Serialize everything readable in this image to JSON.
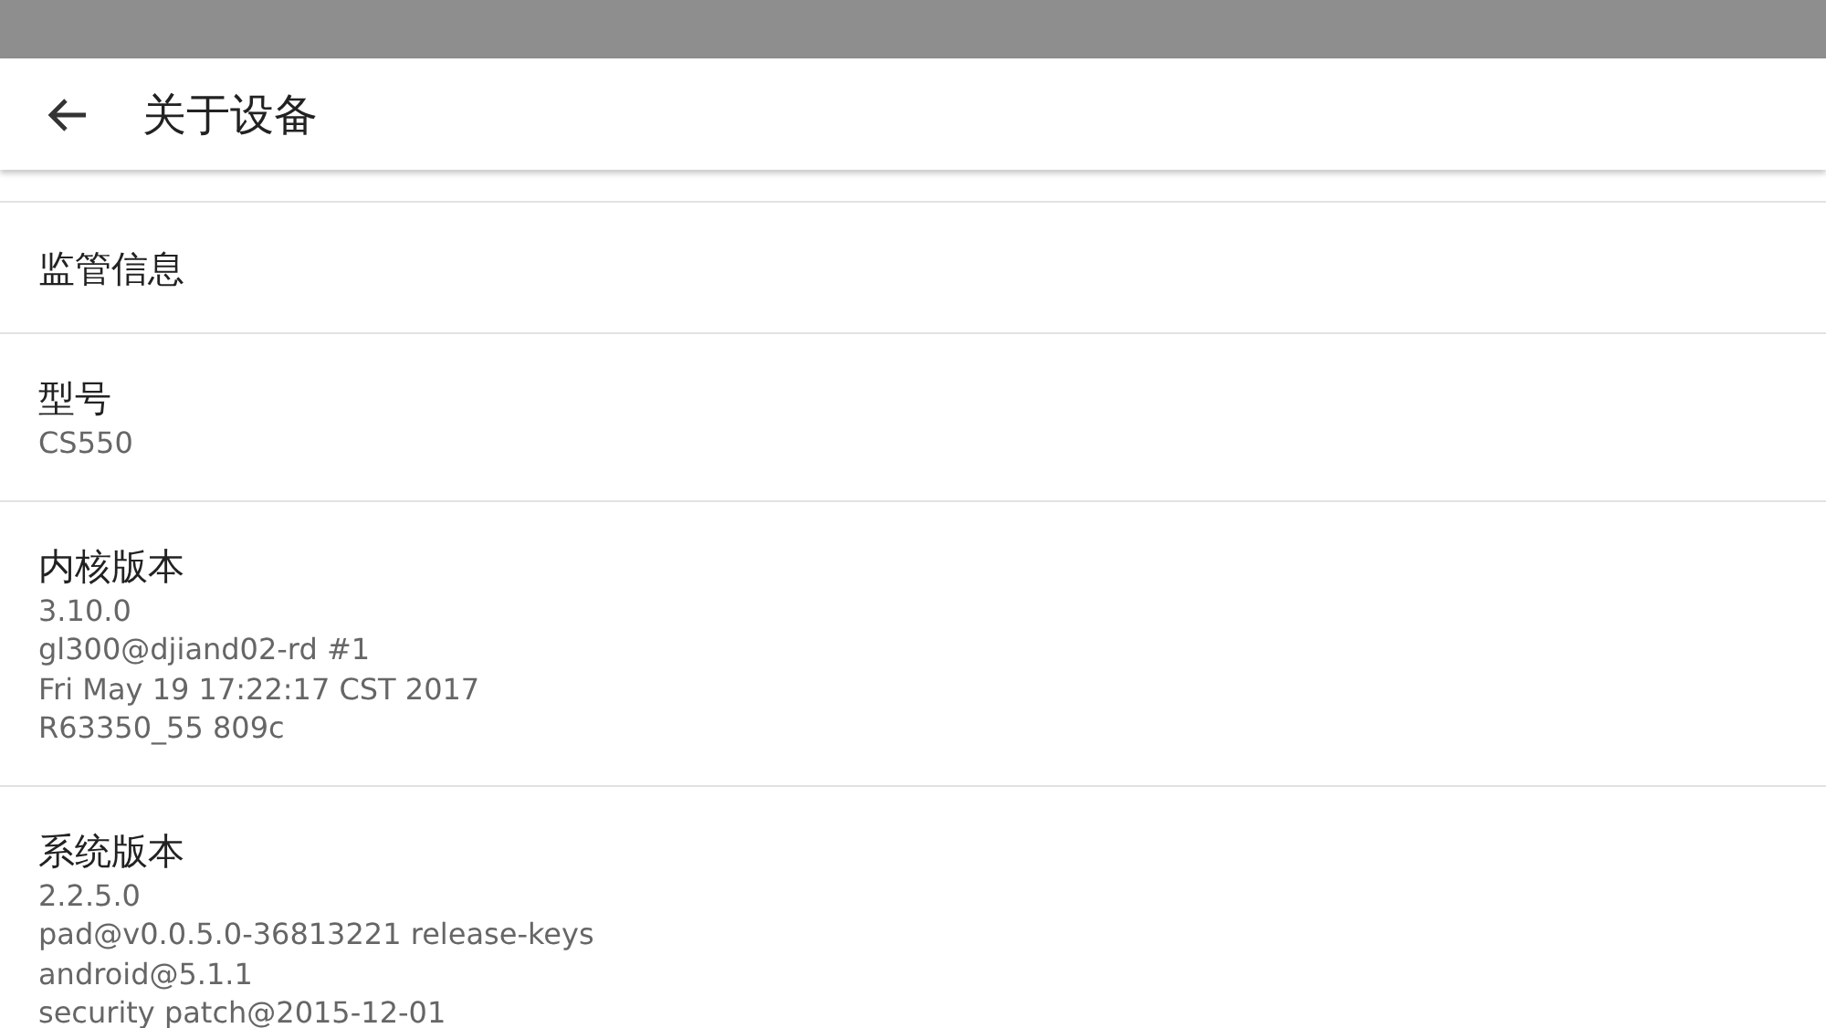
{
  "app_bar": {
    "title": "关于设备"
  },
  "items": [
    {
      "title": "监管信息"
    },
    {
      "title": "型号",
      "lines": [
        "CS550"
      ]
    },
    {
      "title": "内核版本",
      "lines": [
        "3.10.0",
        "gl300@djiand02-rd #1",
        "Fri May 19 17:22:17 CST 2017",
        "R63350_55 809c"
      ]
    },
    {
      "title": "系统版本",
      "lines": [
        "2.2.5.0",
        "pad@v0.0.5.0-36813221 release-keys",
        "android@5.1.1",
        "security patch@2015-12-01"
      ]
    }
  ]
}
